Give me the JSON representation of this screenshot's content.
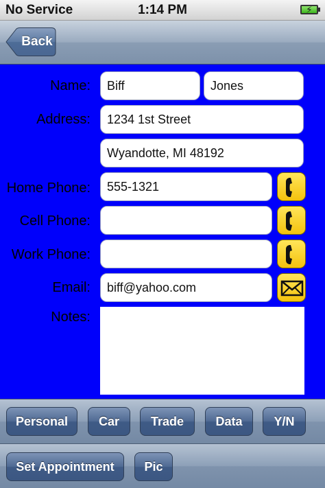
{
  "status_bar": {
    "carrier": "No Service",
    "time": "1:14 PM"
  },
  "nav": {
    "back_label": "Back"
  },
  "form": {
    "name_label": "Name:",
    "first_name": "Biff",
    "last_name": "Jones",
    "address_label": "Address:",
    "address_line1": "1234 1st Street",
    "address_line2": "Wyandotte, MI 48192",
    "home_phone_label": "Home Phone:",
    "home_phone": "555-1321",
    "cell_phone_label": "Cell Phone:",
    "cell_phone": "",
    "work_phone_label": "Work Phone:",
    "work_phone": "",
    "email_label": "Email:",
    "email": "biff@yahoo.com",
    "notes_label": "Notes:",
    "notes": ""
  },
  "toolbar1": {
    "personal": "Personal",
    "car": "Car",
    "trade": "Trade",
    "data": "Data",
    "yn": "Y/N"
  },
  "toolbar2": {
    "set_appointment": "Set Appointment",
    "pic": "Pic"
  },
  "colors": {
    "form_bg": "#0000fb",
    "call_button": "#f4c20d",
    "nav_blue": "#3f5b86"
  },
  "icons": {
    "call": "phone-handset-icon",
    "email": "envelope-icon",
    "battery": "battery-charging-icon"
  }
}
